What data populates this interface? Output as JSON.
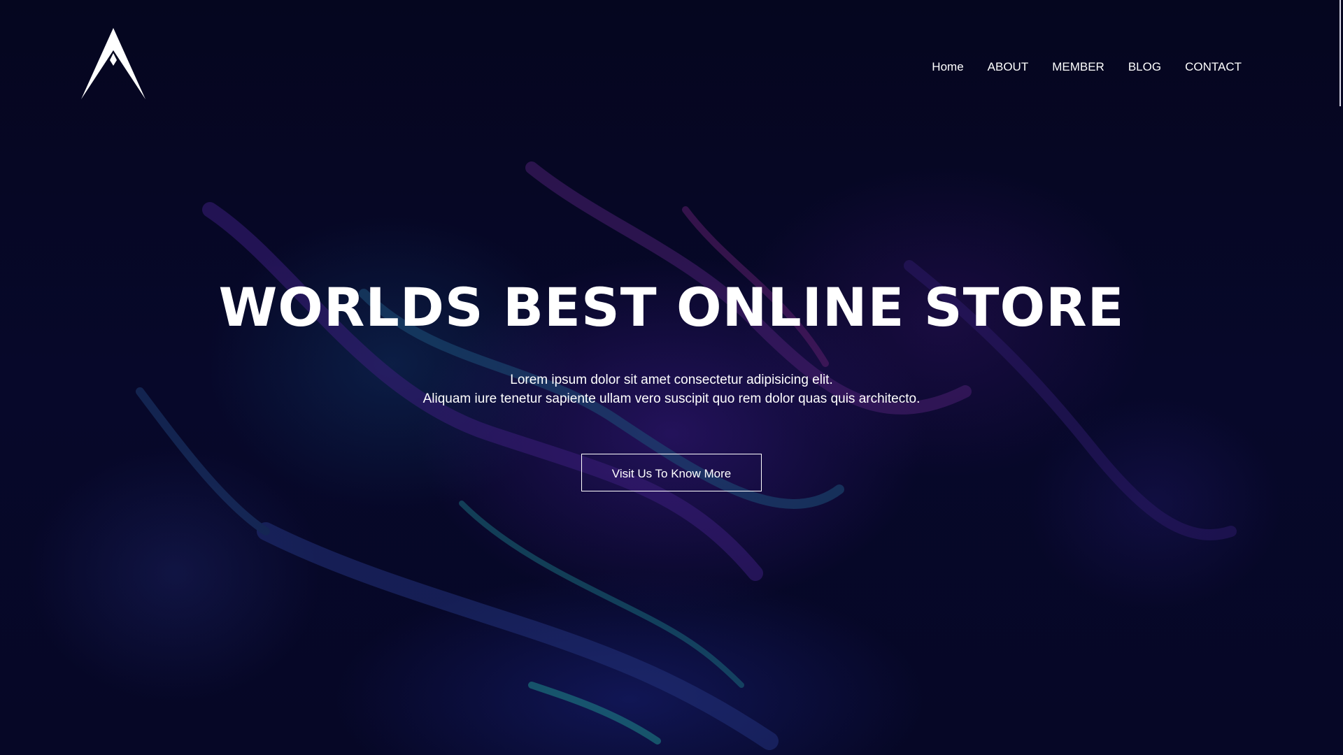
{
  "header": {
    "logo_icon": "mountain-a-logo",
    "nav": [
      {
        "label": "Home"
      },
      {
        "label": "ABOUT"
      },
      {
        "label": "MEMBER"
      },
      {
        "label": "BLOG"
      },
      {
        "label": "CONTACT"
      }
    ]
  },
  "hero": {
    "title": "WORLDS BEST ONLINE STORE",
    "line1": "Lorem ipsum dolor sit amet consectetur adipisicing elit.",
    "line2": "Aliquam iure tenetur sapiente ullam vero suscipit quo rem dolor quas quis architecto.",
    "cta_label": "Visit Us To Know More"
  },
  "colors": {
    "background": "#05061f",
    "text": "#ffffff",
    "accent_purple": "#5a2aa0",
    "accent_teal": "#1f6f8b"
  }
}
